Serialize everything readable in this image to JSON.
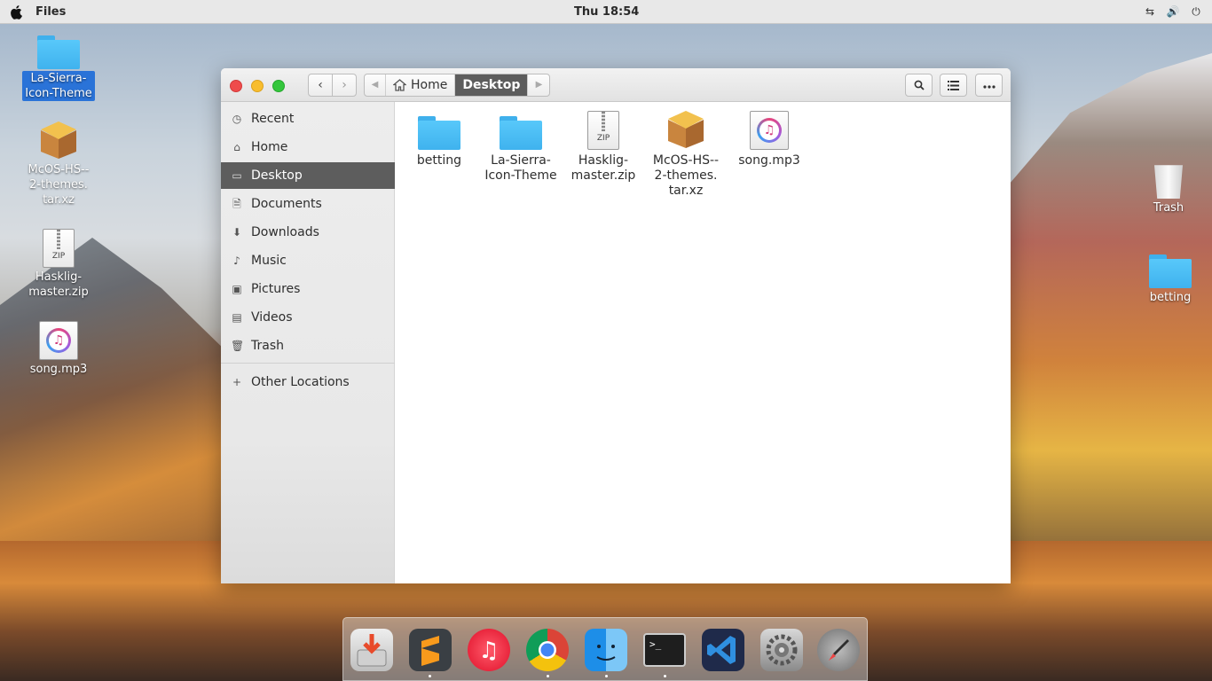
{
  "topbar": {
    "app_name": "Files",
    "clock": "Thu 18:54",
    "tray": [
      "network-icon",
      "volume-icon",
      "power-icon"
    ]
  },
  "desktop_left": [
    {
      "label": "La-Sierra-Icon-Theme",
      "line1": "La-Sierra-",
      "line2": "Icon-Theme",
      "icon": "folder-icon",
      "selected": true
    },
    {
      "label": "McOS-HS--2-themes.tar.xz",
      "line1": "McOS-HS--",
      "line2": "2-themes.",
      "line3": "tar.xz",
      "icon": "package-icon"
    },
    {
      "label": "Hasklig-master.zip",
      "line1": "Hasklig-",
      "line2": "master.zip",
      "icon": "zip-icon"
    },
    {
      "label": "song.mp3",
      "line1": "song.mp3",
      "icon": "music-file-icon"
    }
  ],
  "desktop_right": [
    {
      "label": "Trash",
      "icon": "trash-icon"
    },
    {
      "label": "betting",
      "icon": "folder-icon"
    }
  ],
  "window": {
    "nav_back": "‹",
    "nav_fwd": "›",
    "breadcrumb": [
      {
        "label": "Home"
      },
      {
        "label": "Desktop"
      }
    ],
    "sidebar": [
      {
        "label": "Recent",
        "icon": "clock-icon"
      },
      {
        "label": "Home",
        "icon": "home-icon"
      },
      {
        "label": "Desktop",
        "icon": "desktop-icon",
        "active": true
      },
      {
        "label": "Documents",
        "icon": "documents-icon"
      },
      {
        "label": "Downloads",
        "icon": "download-icon"
      },
      {
        "label": "Music",
        "icon": "music-icon"
      },
      {
        "label": "Pictures",
        "icon": "camera-icon"
      },
      {
        "label": "Videos",
        "icon": "video-icon"
      },
      {
        "label": "Trash",
        "icon": "trash-icon"
      },
      {
        "label": "Other Locations",
        "icon": "plus-icon"
      }
    ],
    "files": [
      {
        "name": "betting",
        "line1": "betting",
        "icon": "folder-icon"
      },
      {
        "name": "La-Sierra-Icon-Theme",
        "line1": "La-Sierra-",
        "line2": "Icon-Theme",
        "icon": "folder-icon"
      },
      {
        "name": "Hasklig-master.zip",
        "line1": "Hasklig-",
        "line2": "master.zip",
        "icon": "zip-icon"
      },
      {
        "name": "McOS-HS--2-themes.tar.xz",
        "line1": "McOS-HS--",
        "line2": "2-themes.",
        "line3": "tar.xz",
        "icon": "package-icon"
      },
      {
        "name": "song.mp3",
        "line1": "song.mp3",
        "icon": "music-file-icon"
      }
    ],
    "zip_label": "ZIP"
  },
  "dock": {
    "apps": [
      "installer-icon",
      "sublime-text-icon",
      "music-player-icon",
      "chrome-icon",
      "finder-icon",
      "terminal-icon",
      "vscode-icon",
      "system-settings-icon",
      "launchpad-icon"
    ],
    "terminal_prompt": ">_"
  },
  "colors": {
    "accent": "#2a73d8",
    "sidebar_active": "#5d5d5d",
    "folder": "#4bbdf5"
  }
}
